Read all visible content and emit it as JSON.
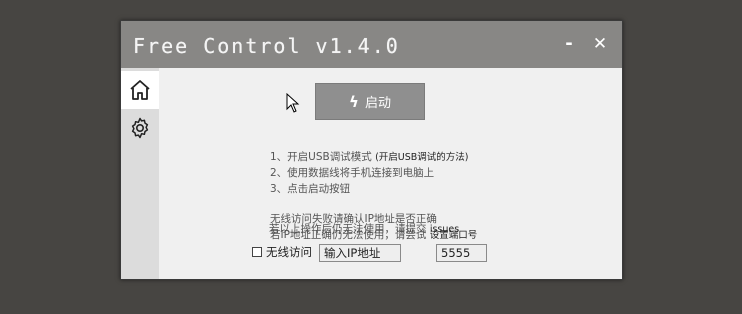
{
  "window": {
    "title": "Free Control v1.4.0",
    "minimize_label": "-",
    "close_label": "✕"
  },
  "sidebar": {
    "items": [
      {
        "name": "home",
        "icon": "home-icon",
        "active": true
      },
      {
        "name": "settings",
        "icon": "gear-icon",
        "active": false
      }
    ]
  },
  "main": {
    "start_button_icon": "bolt-icon",
    "start_button_label": "启动",
    "instructions": {
      "line1": "1、开启USB调试模式 ",
      "line1_link": "(开启USB调试的方法)",
      "line2": "2、使用数据线将手机连接到电脑上",
      "line3": "3、点击启动按钮"
    },
    "wireless_help": {
      "line1": "无线访问失败请确认IP地址是否正确",
      "line2": "若IP地址正确仍无法使用，请尝试 ",
      "line2_link": "设置端口号",
      "line3": "若以上操作后仍无法使用，请提交 ",
      "line3_link": "issues"
    },
    "wireless_checkbox_label": "无线访问",
    "wireless_checked": false,
    "ip_placeholder": "输入IP地址",
    "port_value": "5555"
  },
  "colors": {
    "titlebar": "#888785",
    "background": "#474542",
    "window": "#f0f0f0",
    "sidebar": "#dcdcdc",
    "button": "#8f8f8f"
  }
}
